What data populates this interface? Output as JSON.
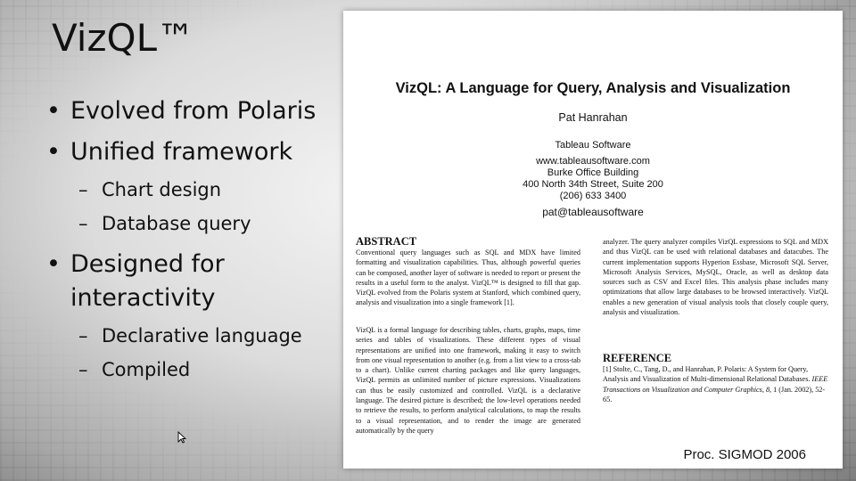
{
  "slide": {
    "title": "VizQL™",
    "bullets": [
      {
        "text": "Evolved from Polaris"
      },
      {
        "text": "Unified framework"
      },
      {
        "text": "Chart design"
      },
      {
        "text": "Database query"
      },
      {
        "text": "Designed for interactivity"
      },
      {
        "text": "Declarative language"
      },
      {
        "text": "Compiled"
      }
    ],
    "credit": "Proc. SIGMOD 2006"
  },
  "paper": {
    "title": "VizQL: A Language for Query, Analysis and Visualization",
    "author": "Pat Hanrahan",
    "affiliation": "Tableau Software",
    "website": "www.tableausoftware.com",
    "building": "Burke Office Building",
    "street": "400 North 34th Street, Suite 200",
    "phone": "(206) 633 3400",
    "email": "pat@tableausoftware",
    "abstract_heading": "ABSTRACT",
    "abstract_p1": "Conventional query languages such as SQL and MDX have limited formatting and visualization capabilities. Thus, although powerful queries can be composed, another layer of software is needed to report or present the results in a useful form to the analyst. VizQL™ is designed to fill that gap. VizQL evolved from the Polaris system at Stanford, which combined query, analysis and visualization into a single framework [1].",
    "abstract_p2": "VizQL is a formal language for describing tables, charts, graphs, maps, time series and tables of visualizations. These different types of visual representations are unified into one framework, making it easy to switch from one visual representation to another (e.g. from a list view to a cross-tab to a chart). Unlike current charting packages and like query languages, VizQL permits an unlimited number of picture expressions. Visualizations can thus be easily customized and controlled. VizQL is a declarative language. The desired picture is described; the low-level operations needed to retrieve the results, to perform analytical calculations, to map the results to a visual representation, and to render the image are generated automatically by the query",
    "right_p1": "analyzer. The query analyzer compiles VizQL expressions to SQL and MDX and thus VizQL can be used with relational databases and datacubes. The current implementation supports Hyperion Essbase, Microsoft SQL Server, Microsoft Analysis Services, MySQL, Oracle, as well as desktop data sources such as CSV and Excel files. This analysis phase includes many optimizations that allow large databases to be browsed interactively. VizQL enables a new generation of visual analysis tools that closely couple query, analysis and visualization.",
    "reference_heading": "REFERENCE",
    "reference_num": "[1]",
    "reference_text": "Stolte, C., Tang, D., and Hanrahan, P. Polaris: A System for Query, Analysis and Visualization of Multi-dimensional Relational Databases.",
    "reference_journal": "IEEE Transactions on Visualization and Computer Graphics, 8,",
    "reference_tail": "1 (Jan. 2002), 52-65."
  }
}
